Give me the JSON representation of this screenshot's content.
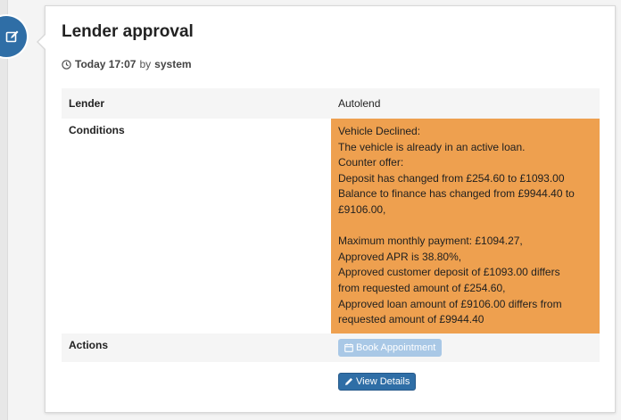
{
  "entry": {
    "title": "Lender approval",
    "meta": {
      "when": "Today 17:07",
      "by_label": "by",
      "author": "system"
    }
  },
  "details": {
    "lender_label": "Lender",
    "lender_value": "Autolend",
    "conditions_label": "Conditions",
    "conditions_lines": [
      "Vehicle Declined:",
      "The vehicle is already in an active loan.",
      "Counter offer:",
      "Deposit has changed from £254.60 to £1093.00",
      "Balance to finance has changed from £9944.40 to",
      "£9106.00,",
      "",
      "Maximum monthly payment: £1094.27,",
      "Approved APR is 38.80%,",
      "Approved customer deposit of £1093.00 differs",
      "from requested amount of £254.60,",
      "Approved loan amount of £9106.00 differs from",
      "requested amount of £9944.40"
    ],
    "actions_label": "Actions",
    "book_appointment_label": "Book Appointment",
    "view_details_label": "View Details"
  },
  "icons": {
    "timeline": "edit-icon",
    "meta": "clock-icon",
    "book": "calendar-icon",
    "view": "pencil-icon"
  },
  "colors": {
    "accent": "#2f6ea6",
    "conditions_bg": "#eea04f",
    "disabled_button": "#a9c8e6"
  }
}
